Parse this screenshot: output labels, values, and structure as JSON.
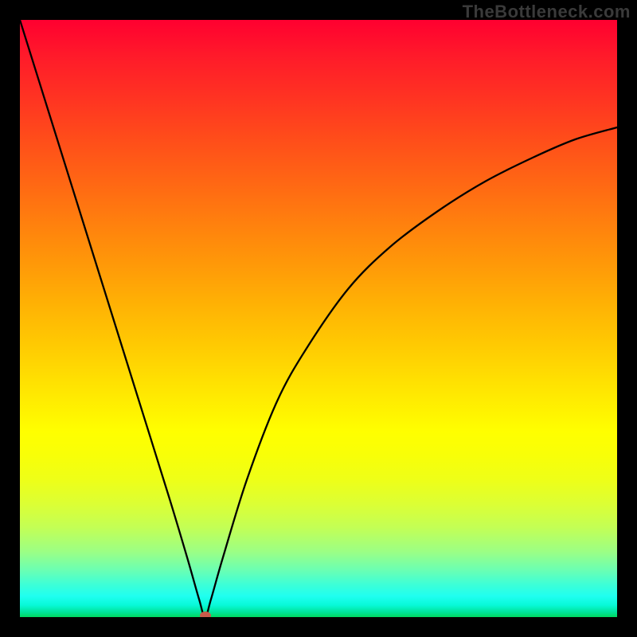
{
  "watermark": "TheBottleneck.com",
  "colors": {
    "frame": "#000000",
    "curve": "#000000",
    "marker": "#c85a4a"
  },
  "chart_data": {
    "type": "line",
    "title": "",
    "xlabel": "",
    "ylabel": "",
    "xlim": [
      0,
      100
    ],
    "ylim": [
      0,
      100
    ],
    "grid": false,
    "annotations": [
      "TheBottleneck.com"
    ],
    "description": "V-shaped bottleneck curve: falls from top-left to a minimum near x≈31, then rises asymptotically toward the upper right. Background is a vertical heat gradient (red top → green bottom). A small marker sits at the minimum.",
    "series": [
      {
        "name": "bottleneck-curve",
        "x": [
          0,
          5,
          10,
          15,
          20,
          25,
          28,
          30,
          31,
          32,
          34,
          38,
          43,
          48,
          55,
          62,
          70,
          78,
          86,
          93,
          100
        ],
        "y": [
          100,
          84,
          68,
          52,
          36,
          20,
          10,
          3,
          0,
          3,
          10,
          23,
          36,
          45,
          55,
          62,
          68,
          73,
          77,
          80,
          82
        ]
      }
    ],
    "marker": {
      "x": 31,
      "y": 0
    }
  }
}
